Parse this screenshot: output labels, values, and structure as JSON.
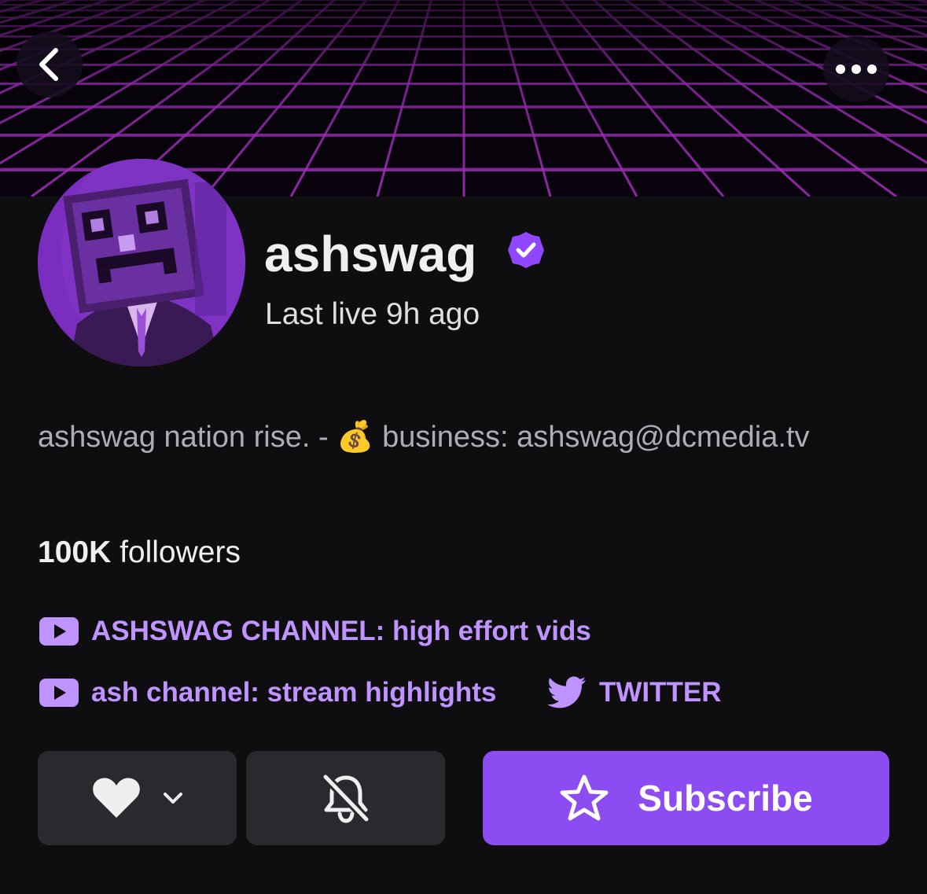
{
  "header": {
    "back_icon": "chevron-left-icon",
    "more_icon": "more-horizontal-icon"
  },
  "profile": {
    "name": "ashswag",
    "verified_icon": "verified-badge-icon",
    "last_live": "Last live 9h ago",
    "bio_prefix": "ashswag nation rise. - ",
    "bio_emoji": "💰",
    "bio_suffix": " business: ashswag@dcmedia.tv",
    "followers_count": "100K",
    "followers_label": " followers"
  },
  "links": [
    {
      "icon": "youtube-icon",
      "label": "ASHSWAG CHANNEL: high effort vids"
    },
    {
      "icon": "youtube-icon",
      "label": "ash channel: stream highlights"
    },
    {
      "icon": "twitter-bird-icon",
      "label": "TWITTER"
    }
  ],
  "actions": {
    "follow_icon": "heart-icon",
    "follow_dropdown_icon": "chevron-down-icon",
    "notify_icon": "bell-off-icon",
    "subscribe_icon": "star-icon",
    "subscribe_label": "Subscribe"
  },
  "colors": {
    "background": "#0e0e10",
    "accent": "#8c4cf2",
    "link": "#bf94ff",
    "button": "#2a2a2e",
    "banner_grid": "#a42fc0"
  }
}
